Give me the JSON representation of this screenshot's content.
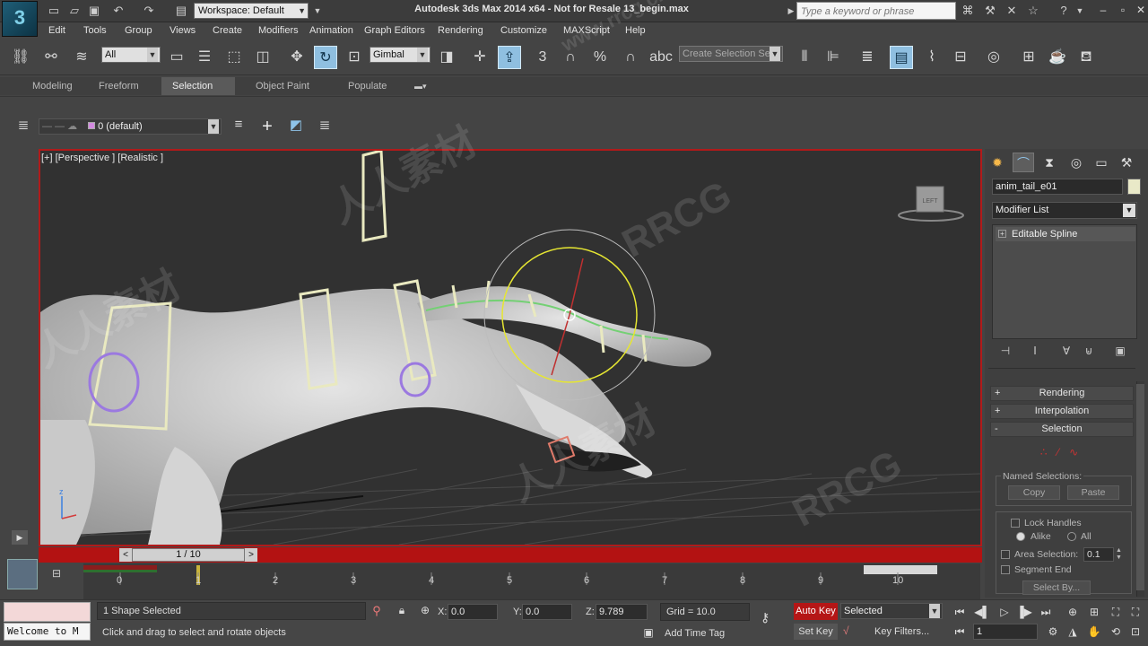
{
  "app": {
    "logo_text": "3",
    "title": "Autodesk 3ds Max  2014 x64  - Not for Resale   13_begin.max",
    "workspace": "Workspace: Default",
    "search_placeholder": "Type a keyword or phrase",
    "watermarks": [
      "www.rrcg.cn",
      "RRCG",
      "人人素材"
    ]
  },
  "menu": [
    "Edit",
    "Tools",
    "Group",
    "Views",
    "Create",
    "Modifiers",
    "Animation",
    "Graph Editors",
    "Rendering",
    "Customize",
    "MAXScript",
    "Help"
  ],
  "toolbar": {
    "selection_filter": "All",
    "ref_coord": "Gimbal",
    "snap_label": "3",
    "angle_snap_label": "%",
    "named_selection_placeholder": "Create Selection Se"
  },
  "ribbon": {
    "tabs": [
      "Modeling",
      "Freeform",
      "Selection",
      "Object Paint",
      "Populate"
    ],
    "active": "Selection"
  },
  "layer": {
    "current": "0 (default)"
  },
  "viewport": {
    "label": "[+] [Perspective ] [Realistic ]",
    "viewcube_face": "LEFT",
    "axis_z": "z"
  },
  "command_panel": {
    "object_name": "anim_tail_e01",
    "modifier_list": "Modifier List",
    "stack": [
      "Editable Spline"
    ],
    "rollouts": [
      {
        "sign": "+",
        "label": "Rendering"
      },
      {
        "sign": "+",
        "label": "Interpolation"
      },
      {
        "sign": "-",
        "label": "Selection"
      }
    ],
    "named_selections_label": "Named Selections:",
    "copy": "Copy",
    "paste": "Paste",
    "lock_handles": "Lock Handles",
    "alike": "Alike",
    "all": "All",
    "area_selection": "Area Selection:",
    "area_value": "0.1",
    "segment_end": "Segment End",
    "select_by": "Select By..."
  },
  "timeline": {
    "frame": "1 / 10",
    "ticks": [
      "0",
      "1",
      "2",
      "3",
      "4",
      "5",
      "6",
      "7",
      "8",
      "9",
      "10"
    ]
  },
  "status": {
    "selection": "1 Shape Selected",
    "prompt": "Click and drag to select and rotate objects",
    "welcome": "Welcome to M",
    "x_label": "X:",
    "x": "0.0",
    "y_label": "Y:",
    "y": "0.0",
    "z_label": "Z:",
    "z": "9.789",
    "grid": "Grid = 10.0",
    "add_time_tag": "Add Time Tag",
    "auto_key": "Auto Key",
    "set_key": "Set Key",
    "key_mode": "Selected",
    "key_filters": "Key Filters...",
    "current_frame": "1"
  },
  "colors": {
    "accent_red": "#b31212",
    "active_button": "#8fbfe0",
    "viewport_bg": "#313131"
  }
}
